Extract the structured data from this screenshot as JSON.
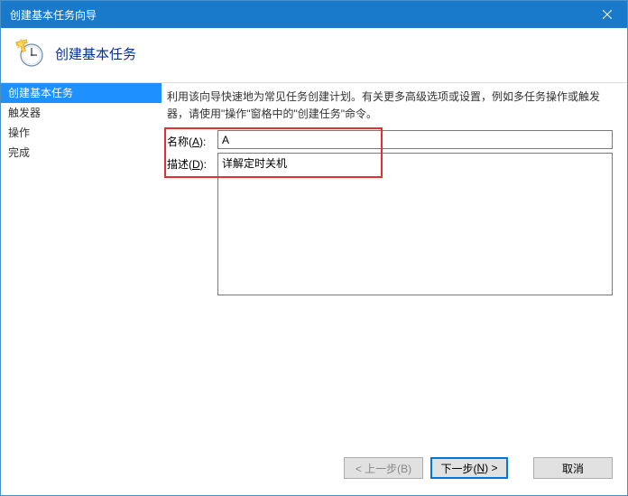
{
  "window": {
    "title": "创建基本任务向导"
  },
  "header": {
    "title": "创建基本任务",
    "icon": "clock-new-icon"
  },
  "sidebar": {
    "items": [
      {
        "label": "创建基本任务",
        "active": true
      },
      {
        "label": "触发器",
        "active": false
      },
      {
        "label": "操作",
        "active": false
      },
      {
        "label": "完成",
        "active": false
      }
    ]
  },
  "main": {
    "intro": "利用该向导快速地为常见任务创建计划。有关更多高级选项或设置，例如多任务操作或触发器，请使用\"操作\"窗格中的\"创建任务\"命令。",
    "name_label": "名称(A):",
    "name_value": "A",
    "desc_label": "描述(D):",
    "desc_value": "详解定时关机"
  },
  "footer": {
    "back": "< 上一步(B)",
    "next": "下一步(N) >",
    "cancel": "取消"
  }
}
